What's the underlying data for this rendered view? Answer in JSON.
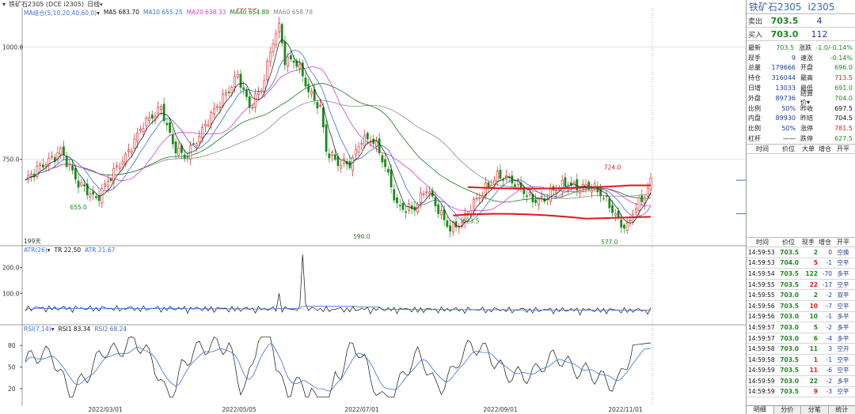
{
  "titlebar": {
    "arrow": "▾",
    "instrument": "铁矿石2305 (DCE i2305)",
    "period": "日线",
    "period_caret": "▾"
  },
  "ma_legend": {
    "group": "MA组合(5,10,20,40,60,0)",
    "group_caret": "▾",
    "items": [
      {
        "text": "MA5 683.70",
        "color": "#111111"
      },
      {
        "text": "MA10 655.25",
        "color": "#3a6fd6"
      },
      {
        "text": "MA20 638.33",
        "color": "#d63ad6"
      },
      {
        "text": "MA40 654.89",
        "color": "#1a7a1a"
      },
      {
        "text": "MA60 658.78",
        "color": "#8a8a8a"
      }
    ]
  },
  "atr_legend": {
    "group": "ATR(26)",
    "group_caret": "▾",
    "items": [
      {
        "text": "TR 22.50",
        "color": "#111111"
      },
      {
        "text": "ATR 21.67",
        "color": "#3a6fd6"
      }
    ]
  },
  "rsi_legend": {
    "group": "RSI(7,14)",
    "group_caret": "▾",
    "items": [
      {
        "text": "RSI1 83.34",
        "color": "#111111"
      },
      {
        "text": "RSI2 68.24",
        "color": "#3a6fd6"
      }
    ]
  },
  "price_axis_labels": [
    "1000.0",
    "750.0"
  ],
  "atr_axis_labels": [
    "200.0",
    "100.0"
  ],
  "rsi_axis_labels": [
    "80",
    "50",
    "20"
  ],
  "bars_label": "199天",
  "annotations": [
    {
      "text": "1070.0",
      "color": "#d62020"
    },
    {
      "text": "655.0",
      "color": "#1a8a1a"
    },
    {
      "text": "590.0",
      "color": "#1a8a1a"
    },
    {
      "text": "623.5",
      "color": "#1a8a1a"
    },
    {
      "text": "577.0",
      "color": "#1a8a1a"
    },
    {
      "text": "724.0",
      "color": "#d62020"
    }
  ],
  "dates": [
    "2022/03/01",
    "2022/05/05",
    "2022/07/01",
    "2022/09/01",
    "2022/11/01"
  ],
  "chart_data": {
    "type": "candlestick",
    "title": "铁矿石2305 (DCE i2305) 日线",
    "price_ylim": [
      570,
      1080
    ],
    "price_ticks": [
      1000,
      750
    ],
    "price_marks": {
      "high": 1070.0,
      "lows": [
        655.0,
        590.0,
        623.5,
        577.0
      ],
      "recent_high": 724.0
    },
    "ma": {
      "MA5": 683.7,
      "MA10": 655.25,
      "MA20": 638.33,
      "MA40": 654.89,
      "MA60": 658.78
    },
    "atr": {
      "TR": 22.5,
      "ATR": 21.67,
      "ticks": [
        200,
        100
      ]
    },
    "rsi": {
      "RSI1": 83.34,
      "RSI2": 68.24,
      "ticks": [
        80,
        50,
        20
      ]
    },
    "trend_lines": "two red horizontal channel lines across the Aug–Nov range",
    "date_ticks": [
      "2022/03/01",
      "2022/05/05",
      "2022/07/01",
      "2022/09/01",
      "2022/11/01"
    ],
    "close_path": [
      [
        0,
        700
      ],
      [
        6,
        735
      ],
      [
        12,
        775
      ],
      [
        18,
        690
      ],
      [
        24,
        665
      ],
      [
        28,
        705
      ],
      [
        34,
        750
      ],
      [
        40,
        835
      ],
      [
        46,
        860
      ],
      [
        50,
        780
      ],
      [
        54,
        760
      ],
      [
        60,
        810
      ],
      [
        68,
        900
      ],
      [
        72,
        940
      ],
      [
        76,
        860
      ],
      [
        80,
        905
      ],
      [
        84,
        1020
      ],
      [
        86,
        1050
      ],
      [
        88,
        970
      ],
      [
        92,
        960
      ],
      [
        96,
        905
      ],
      [
        100,
        870
      ],
      [
        102,
        770
      ],
      [
        106,
        735
      ],
      [
        110,
        740
      ],
      [
        114,
        800
      ],
      [
        118,
        790
      ],
      [
        122,
        730
      ],
      [
        126,
        650
      ],
      [
        132,
        640
      ],
      [
        136,
        680
      ],
      [
        140,
        640
      ],
      [
        144,
        600
      ],
      [
        148,
        605
      ],
      [
        152,
        650
      ],
      [
        156,
        690
      ],
      [
        160,
        715
      ],
      [
        164,
        700
      ],
      [
        168,
        685
      ],
      [
        172,
        665
      ],
      [
        176,
        660
      ],
      [
        180,
        680
      ],
      [
        184,
        700
      ],
      [
        188,
        690
      ],
      [
        190,
        690
      ],
      [
        194,
        675
      ],
      [
        198,
        650
      ],
      [
        202,
        610
      ],
      [
        204,
        600
      ],
      [
        206,
        630
      ],
      [
        210,
        665
      ],
      [
        212,
        700
      ]
    ]
  },
  "quote": {
    "name": "铁矿石2305",
    "code": "i2305",
    "sell": {
      "label": "卖出",
      "price": "703.5",
      "vol": "4"
    },
    "buy": {
      "label": "买入",
      "price": "703.0",
      "vol": "112"
    },
    "stats": [
      {
        "k": "最新",
        "v": "703.5",
        "vc": "c-green",
        "k2": "涨跌",
        "v2": "-1.0/-0.14%",
        "v2c": "c-green"
      },
      {
        "k": "现手",
        "v": "9",
        "vc": "c-blue",
        "k2": "速涨",
        "v2": "-0.14%",
        "v2c": "c-green"
      },
      {
        "k": "总量",
        "v": "179666",
        "vc": "c-blue",
        "k2": "开盘",
        "v2": "696.0",
        "v2c": "c-green"
      },
      {
        "k": "持仓",
        "v": "316044",
        "vc": "c-blue",
        "k2": "最高",
        "v2": "713.5",
        "v2c": "c-red"
      },
      {
        "k": "日增",
        "v": "13033",
        "vc": "c-blue",
        "k2": "最低",
        "v2": "691.0",
        "v2c": "c-green"
      },
      {
        "k": "外盘",
        "v": "89736",
        "vc": "c-blue",
        "k2": "结算价",
        "v2": "704.0",
        "v2c": "c-green",
        "k2caret": "▾"
      },
      {
        "k": "比例",
        "v": "50%",
        "vc": "c-blue",
        "k2": "昨收",
        "v2": "697.5",
        "v2c": "c-black"
      },
      {
        "k": "内盘",
        "v": "89930",
        "vc": "c-blue",
        "k2": "昨结",
        "v2": "704.5",
        "v2c": "c-black"
      },
      {
        "k": "比例",
        "v": "50%",
        "vc": "c-blue",
        "k2": "涨停",
        "v2": "781.5",
        "v2c": "c-red"
      },
      {
        "k": "杠杆",
        "v": "——",
        "vc": "c-black",
        "k2": "跌停",
        "v2": "627.5",
        "v2c": "c-green"
      }
    ],
    "col_head_1": [
      "时间",
      "价位",
      "大单",
      "增仓",
      "开平"
    ],
    "col_head_2": [
      "时间",
      "价位",
      "现手",
      "增仓",
      "开平"
    ],
    "ticks": [
      {
        "t": "14:59:53",
        "p": "703.5",
        "n": "2",
        "nc": "c-green",
        "oi": "0",
        "ty": "空换"
      },
      {
        "t": "14:59:53",
        "p": "704.0",
        "n": "5",
        "nc": "c-red",
        "oi": "-1",
        "ty": "空平"
      },
      {
        "t": "14:59:54",
        "p": "703.5",
        "n": "122",
        "nc": "c-green",
        "oi": "-70",
        "ty": "多平"
      },
      {
        "t": "14:59:55",
        "p": "703.5",
        "n": "22",
        "nc": "c-red",
        "oi": "-17",
        "ty": "空平"
      },
      {
        "t": "14:59:55",
        "p": "703.0",
        "n": "2",
        "nc": "c-green",
        "oi": "-2",
        "ty": "双平"
      },
      {
        "t": "14:59:56",
        "p": "703.5",
        "n": "10",
        "nc": "c-red",
        "oi": "-7",
        "ty": "空平"
      },
      {
        "t": "14:59:56",
        "p": "703.0",
        "n": "10",
        "nc": "c-green",
        "oi": "-1",
        "ty": "多平"
      },
      {
        "t": "14:59:57",
        "p": "703.0",
        "n": "5",
        "nc": "c-green",
        "oi": "-2",
        "ty": "多平"
      },
      {
        "t": "14:59:57",
        "p": "703.0",
        "n": "6",
        "nc": "c-green",
        "oi": "-4",
        "ty": "多平"
      },
      {
        "t": "14:59:58",
        "p": "703.0",
        "n": "11",
        "nc": "c-green",
        "oi": "3",
        "ty": "空开"
      },
      {
        "t": "14:59:58",
        "p": "703.5",
        "n": "1",
        "nc": "c-red",
        "oi": "-1",
        "ty": "空平"
      },
      {
        "t": "14:59:59",
        "p": "703.5",
        "n": "11",
        "nc": "c-red",
        "oi": "-6",
        "ty": "空平"
      },
      {
        "t": "14:59:59",
        "p": "703.0",
        "n": "22",
        "nc": "c-green",
        "oi": "-2",
        "ty": "多平"
      },
      {
        "t": "14:59:59",
        "p": "703.5",
        "n": "9",
        "nc": "c-red",
        "oi": "-3",
        "ty": "空平"
      }
    ],
    "tabs": [
      "明细",
      "分价",
      "分笔",
      "统计"
    ]
  }
}
